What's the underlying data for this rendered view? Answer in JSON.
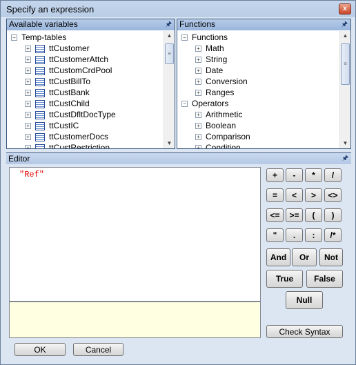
{
  "window": {
    "title": "Specify an expression",
    "close_icon": "close-icon"
  },
  "variables": {
    "header": "Available variables",
    "root": "Temp-tables",
    "items": [
      "ttCustomer",
      "ttCustomerAttch",
      "ttCustomCrdPool",
      "ttCustBillTo",
      "ttCustBank",
      "ttCustChild",
      "ttCustDfltDocType",
      "ttCustIC",
      "ttCustomerDocs",
      "ttCustRestriction"
    ]
  },
  "functions": {
    "header": "Functions",
    "groups": [
      {
        "label": "Functions",
        "children": [
          "Math",
          "String",
          "Date",
          "Conversion",
          "Ranges"
        ]
      },
      {
        "label": "Operators",
        "children": [
          "Arithmetic",
          "Boolean",
          "Comparison",
          "Condition"
        ]
      }
    ]
  },
  "editor": {
    "header": "Editor",
    "text": "\"Ref\"",
    "text_color": "#e00000"
  },
  "operators": [
    [
      "+",
      "-",
      "*",
      "/"
    ],
    [
      "=",
      "<",
      ">",
      "<>"
    ],
    [
      "<=",
      ">=",
      "(",
      ")"
    ],
    [
      "\"",
      ".",
      ":",
      "/*"
    ]
  ],
  "logic": [
    "And",
    "Or",
    "Not"
  ],
  "booleans": [
    "True",
    "False"
  ],
  "null_label": "Null",
  "check_syntax": "Check Syntax",
  "ok": "OK",
  "cancel": "Cancel"
}
